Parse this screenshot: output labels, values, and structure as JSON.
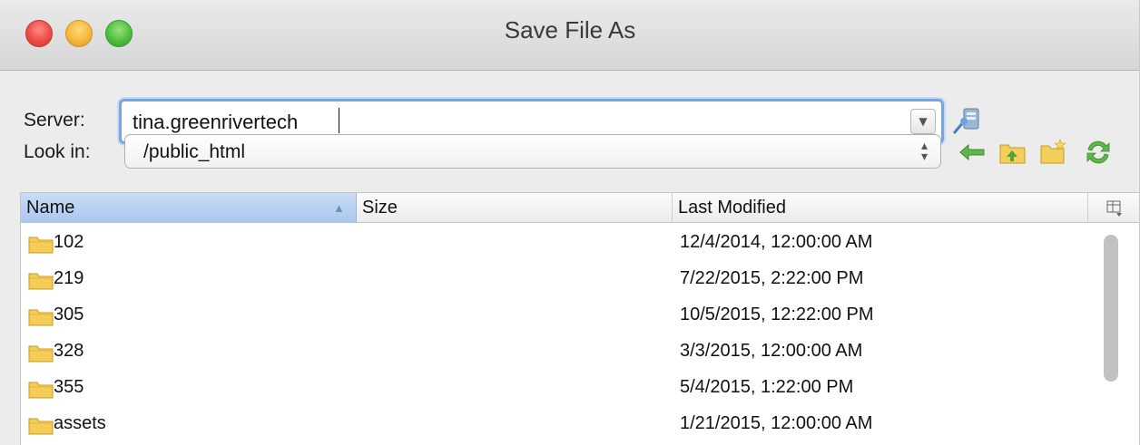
{
  "window": {
    "title": "Save File As"
  },
  "server": {
    "label": "Server:",
    "value": "tina.greenrivertech"
  },
  "lookin": {
    "label": "Look in:",
    "value": "/public_html"
  },
  "toolbar": {
    "icons": [
      "connect-icon",
      "back-arrow-icon",
      "up-folder-icon",
      "new-folder-icon",
      "refresh-icon"
    ]
  },
  "table": {
    "columns": {
      "name": "Name",
      "size": "Size",
      "modified": "Last Modified"
    },
    "sort": {
      "column": "Name",
      "direction": "ascending"
    },
    "rows": [
      {
        "name": "102",
        "size": "",
        "modified": "12/4/2014, 12:00:00 AM"
      },
      {
        "name": "219",
        "size": "",
        "modified": "7/22/2015, 2:22:00 PM"
      },
      {
        "name": "305",
        "size": "",
        "modified": "10/5/2015, 12:22:00 PM"
      },
      {
        "name": "328",
        "size": "",
        "modified": "3/3/2015, 12:00:00 AM"
      },
      {
        "name": "355",
        "size": "",
        "modified": "5/4/2015, 1:22:00 PM"
      },
      {
        "name": "assets",
        "size": "",
        "modified": "1/21/2015, 12:00:00 AM"
      }
    ]
  },
  "colors": {
    "accent": "#76a6e0",
    "selected_header": "#b7d0f1",
    "folder": "#f2c94c"
  }
}
